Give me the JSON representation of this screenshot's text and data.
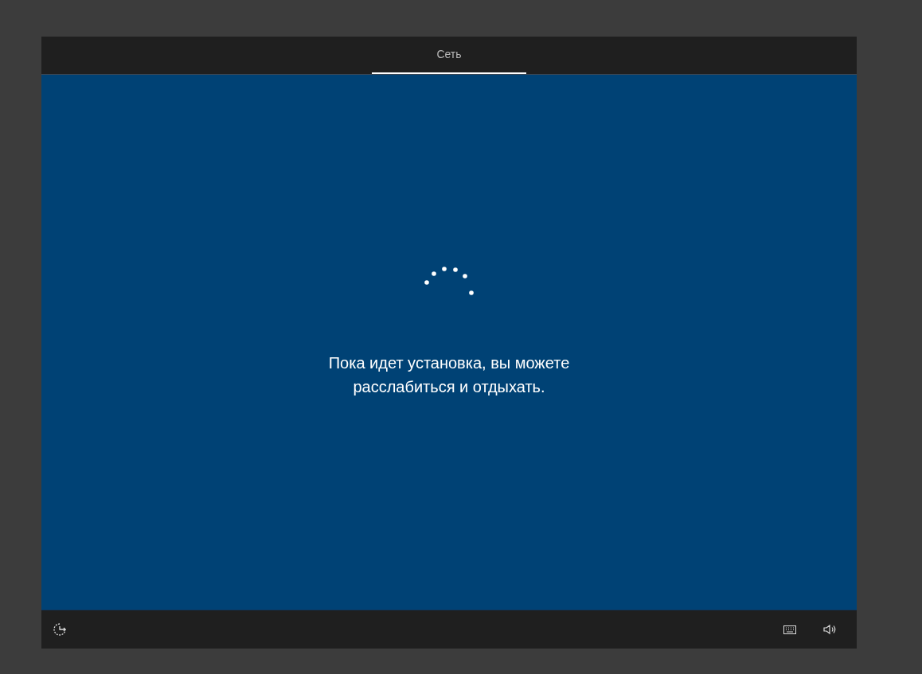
{
  "tabs": [
    {
      "label": "Сеть",
      "selected": true
    }
  ],
  "message": "Пока идет установка, вы можете расслабиться и отдыхать."
}
